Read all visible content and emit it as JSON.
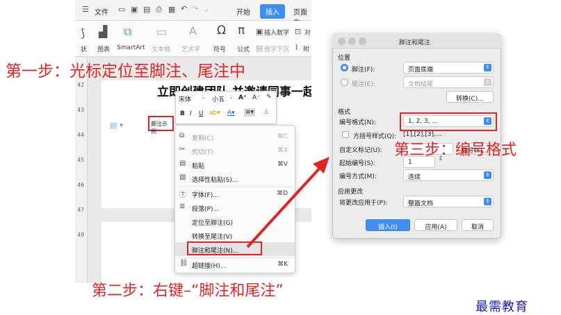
{
  "word": {
    "menu": {
      "hamburger_icon": "menu-icon",
      "file": "文件",
      "start": "开始",
      "insert": "插入",
      "page": "页面布"
    },
    "ribbon": {
      "items": [
        "状",
        "图表",
        "SmartArt",
        "文本框",
        "艺术字",
        "符号",
        "公式"
      ],
      "insert_number": "插入数字",
      "align": "对",
      "drop_cap": "首字下沉",
      "extra": "附"
    },
    "ruler": [
      "42",
      "43",
      "44",
      "45",
      "46",
      "47",
      "48"
    ],
    "title": "立即创建团队 并邀请同事一起",
    "footnote_sample": "脚注示例",
    "mini_toolbar": {
      "font": "宋体",
      "size": "小五"
    },
    "context_menu": [
      {
        "label": "复制(C)",
        "shortcut": "⌘C",
        "disabled": true,
        "icon": "copy-icon"
      },
      {
        "label": "剪切(T)",
        "shortcut": "⌘X",
        "disabled": true,
        "icon": "cut-icon"
      },
      {
        "label": "粘贴",
        "shortcut": "⌘V",
        "disabled": false,
        "icon": "paste-icon"
      },
      {
        "label": "选择性粘贴(S)...",
        "shortcut": "",
        "disabled": false,
        "icon": "paste-special-icon"
      },
      {
        "label": "字体(F)...",
        "shortcut": "⌘D",
        "disabled": false,
        "icon": "font-icon"
      },
      {
        "label": "段落(P)...",
        "shortcut": "",
        "disabled": false,
        "icon": "paragraph-icon"
      },
      {
        "label": "定位至脚注(G)",
        "shortcut": "",
        "disabled": false,
        "icon": ""
      },
      {
        "label": "转换至尾注(V)",
        "shortcut": "",
        "disabled": false,
        "icon": ""
      },
      {
        "label": "脚注和尾注(N)...",
        "shortcut": "",
        "disabled": false,
        "icon": ""
      },
      {
        "label": "超链接(H)...",
        "shortcut": "⌘K",
        "disabled": false,
        "icon": "link-icon"
      }
    ]
  },
  "dialog": {
    "title": "脚注和尾注",
    "position_section": "位置",
    "footnote_label": "脚注(F):",
    "footnote_value": "页面底端",
    "endnote_label": "尾注(E):",
    "endnote_value": "文档结尾",
    "convert_button": "转换(C)...",
    "format_section": "格式",
    "number_format_label": "编号格式(N):",
    "number_format_value": "1, 2, 3, ...",
    "bracket_label": "方括号样式(Q):",
    "bracket_value": "[1],[2],[3],...",
    "custom_mark_label": "自定义标记(U):",
    "symbol_button": "符号(Y)...",
    "start_number_label": "起始编号(S):",
    "start_number_value": "1",
    "numbering_label": "编号方式(M):",
    "numbering_value": "连续",
    "apply_section": "应用更改",
    "apply_to_label": "将更改应用于(P):",
    "apply_to_value": "整篇文档",
    "insert_button": "插入(I)",
    "apply_button": "应用(A)",
    "cancel_button": "取消"
  },
  "annotations": {
    "step1": "第一步：光标定位至脚注、尾注中",
    "step2": "第二步：右键–“脚注和尾注”",
    "step3": "第三步：编号格式"
  },
  "brand": "最需教育",
  "colors": {
    "annotation_red": "#e02424",
    "accent_blue": "#3f8ef0",
    "brand_blue": "#1a1ab8"
  }
}
